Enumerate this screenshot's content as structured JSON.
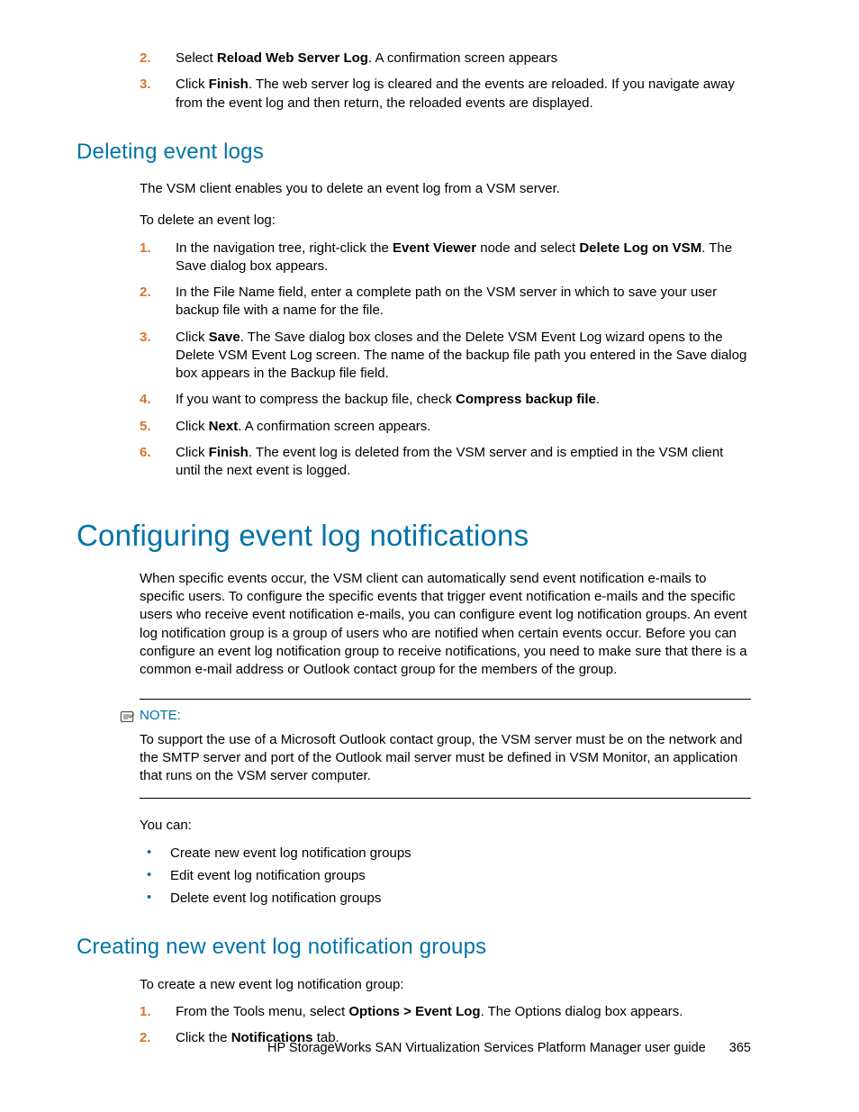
{
  "top_list": [
    {
      "n": "2.",
      "pre": "Select ",
      "bold": "Reload Web Server Log",
      "post": ". A confirmation screen appears"
    },
    {
      "n": "3.",
      "pre": "Click ",
      "bold": "Finish",
      "post": ". The web server log is cleared and the events are reloaded. If you navigate away from the event log and then return, the reloaded events are displayed."
    }
  ],
  "deleting": {
    "heading": "Deleting event logs",
    "p1": "The VSM client enables you to delete an event log from a VSM server.",
    "p2": "To delete an event log:",
    "steps": [
      {
        "n": "1.",
        "parts": [
          "In the navigation tree, right-click the ",
          {
            "b": "Event Viewer"
          },
          " node and select ",
          {
            "b": "Delete Log on VSM"
          },
          ". The Save dialog box appears."
        ]
      },
      {
        "n": "2.",
        "parts": [
          "In the File Name field, enter a complete path on the VSM server in which to save your user backup file with a name for the file."
        ]
      },
      {
        "n": "3.",
        "parts": [
          "Click ",
          {
            "b": "Save"
          },
          ". The Save dialog box closes and the Delete VSM Event Log wizard opens to the Delete VSM Event Log screen. The name of the backup file path you entered in the Save dialog box appears in the Backup file field."
        ]
      },
      {
        "n": "4.",
        "parts": [
          "If you want to compress the backup file, check ",
          {
            "b": "Compress backup file"
          },
          "."
        ]
      },
      {
        "n": "5.",
        "parts": [
          "Click ",
          {
            "b": "Next"
          },
          ". A confirmation screen appears."
        ]
      },
      {
        "n": "6.",
        "parts": [
          "Click ",
          {
            "b": "Finish"
          },
          ". The event log is deleted from the VSM server and is emptied in the VSM client until the next event is logged."
        ]
      }
    ]
  },
  "configuring": {
    "heading": "Configuring event log notifications",
    "p1": "When specific events occur, the VSM client can automatically send event notification e-mails to specific users. To configure the specific events that trigger event notification e-mails and the specific users who receive event notification e-mails, you can configure event log notification groups. An event log notification group is a group of users who are notified when certain events occur. Before you can configure an event log notification group to receive notifications, you need to make sure that there is a common e-mail address or Outlook contact group for the members of the group.",
    "note_label": "NOTE:",
    "note_body": "To support the use of a Microsoft Outlook contact group, the VSM server must be on the network and the SMTP server and port of the Outlook mail server must be defined in VSM Monitor, an application that runs on the VSM server computer.",
    "you_can": "You can:",
    "bullets": [
      "Create new event log notification groups",
      "Edit event log notification groups",
      "Delete event log notification groups"
    ]
  },
  "creating": {
    "heading": "Creating new event log notification groups",
    "p1": "To create a new event log notification group:",
    "steps": [
      {
        "n": "1.",
        "parts": [
          "From the Tools menu, select ",
          {
            "b": "Options > Event Log"
          },
          ". The Options dialog box appears."
        ]
      },
      {
        "n": "2.",
        "parts": [
          "Click the ",
          {
            "b": "Notifications"
          },
          " tab."
        ]
      }
    ]
  },
  "footer": {
    "title": "HP StorageWorks SAN Virtualization Services Platform Manager user guide",
    "page": "365"
  }
}
